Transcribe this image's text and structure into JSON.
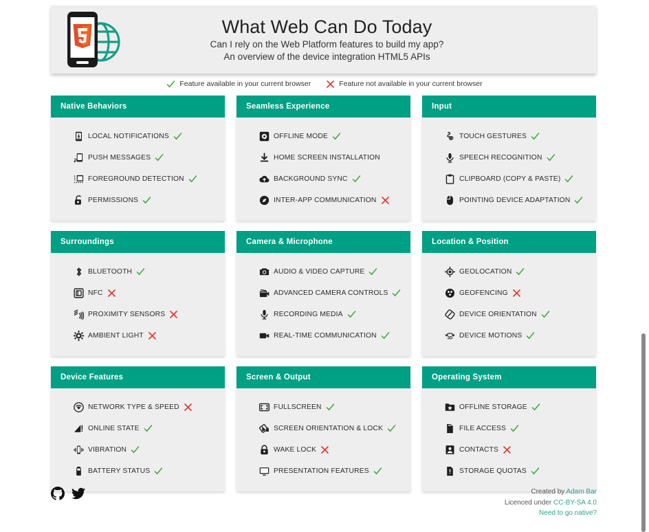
{
  "header": {
    "title": "What Web Can Do Today",
    "subtitle_line1": "Can I rely on the Web Platform features to build my app?",
    "subtitle_line2": "An overview of the device integration HTML5 APIs",
    "logo_icon": "html5-phone-globe-logo"
  },
  "legend": {
    "available": {
      "icon": "check-icon",
      "text": "Feature available in your current browser"
    },
    "unavailable": {
      "icon": "cross-icon",
      "text": "Feature not available in your current browser"
    }
  },
  "colors": {
    "accent_teal": "#00a085",
    "card_bg": "#eeeeee",
    "check_green": "#3aa93a",
    "cross_red": "#e03a2f",
    "link_teal": "#2aa58e",
    "html5_orange": "#e44d26"
  },
  "cards": [
    {
      "title": "Native Behaviors",
      "features": [
        {
          "label": "LOCAL NOTIFICATIONS",
          "icon": "notification-phone-icon",
          "status": "available"
        },
        {
          "label": "PUSH MESSAGES",
          "icon": "push-phone-icon",
          "status": "available"
        },
        {
          "label": "FOREGROUND DETECTION",
          "icon": "foreground-window-icon",
          "status": "available"
        },
        {
          "label": "PERMISSIONS",
          "icon": "lock-open-icon",
          "status": "available"
        }
      ]
    },
    {
      "title": "Seamless Experience",
      "features": [
        {
          "label": "OFFLINE MODE",
          "icon": "offline-gear-icon",
          "status": "available"
        },
        {
          "label": "HOME SCREEN INSTALLATION",
          "icon": "download-arrow-icon",
          "status": "none"
        },
        {
          "label": "BACKGROUND SYNC",
          "icon": "cloud-upload-icon",
          "status": "available"
        },
        {
          "label": "INTER-APP COMMUNICATION",
          "icon": "compass-icon",
          "status": "unavailable"
        }
      ]
    },
    {
      "title": "Input",
      "features": [
        {
          "label": "TOUCH GESTURES",
          "icon": "touch-gesture-icon",
          "status": "available"
        },
        {
          "label": "SPEECH RECOGNITION",
          "icon": "microphone-icon",
          "status": "available"
        },
        {
          "label": "CLIPBOARD (COPY & PASTE)",
          "icon": "clipboard-icon",
          "status": "available"
        },
        {
          "label": "POINTING DEVICE ADAPTATION",
          "icon": "mouse-icon",
          "status": "available"
        }
      ]
    },
    {
      "title": "Surroundings",
      "features": [
        {
          "label": "BLUETOOTH",
          "icon": "bluetooth-icon",
          "status": "available"
        },
        {
          "label": "NFC",
          "icon": "nfc-icon",
          "status": "unavailable"
        },
        {
          "label": "PROXIMITY SENSORS",
          "icon": "proximity-waves-icon",
          "status": "unavailable"
        },
        {
          "label": "AMBIENT LIGHT",
          "icon": "sun-brightness-icon",
          "status": "unavailable"
        }
      ]
    },
    {
      "title": "Camera & Microphone",
      "features": [
        {
          "label": "AUDIO & VIDEO CAPTURE",
          "icon": "camera-icon",
          "status": "available"
        },
        {
          "label": "ADVANCED CAMERA CONTROLS",
          "icon": "film-camera-icon",
          "status": "available"
        },
        {
          "label": "RECORDING MEDIA",
          "icon": "microphone-icon",
          "status": "available"
        },
        {
          "label": "REAL-TIME COMMUNICATION",
          "icon": "video-camera-icon",
          "status": "available"
        }
      ]
    },
    {
      "title": "Location & Position",
      "features": [
        {
          "label": "GEOLOCATION",
          "icon": "crosshair-target-icon",
          "status": "available"
        },
        {
          "label": "GEOFENCING",
          "icon": "geofence-circle-icon",
          "status": "unavailable"
        },
        {
          "label": "DEVICE ORIENTATION",
          "icon": "rotate-device-icon",
          "status": "available"
        },
        {
          "label": "DEVICE MOTIONS",
          "icon": "three-d-motion-icon",
          "status": "available"
        }
      ]
    },
    {
      "title": "Device Features",
      "features": [
        {
          "label": "NETWORK TYPE & SPEED",
          "icon": "network-signal-icon",
          "status": "unavailable"
        },
        {
          "label": "ONLINE STATE",
          "icon": "signal-bars-alert-icon",
          "status": "available"
        },
        {
          "label": "VIBRATION",
          "icon": "vibration-phone-icon",
          "status": "available"
        },
        {
          "label": "BATTERY STATUS",
          "icon": "battery-icon",
          "status": "available"
        }
      ]
    },
    {
      "title": "Screen & Output",
      "features": [
        {
          "label": "FULLSCREEN",
          "icon": "fullscreen-icon",
          "status": "available"
        },
        {
          "label": "SCREEN ORIENTATION & LOCK",
          "icon": "screen-rotate-lock-icon",
          "status": "available"
        },
        {
          "label": "WAKE LOCK",
          "icon": "lock-closed-icon",
          "status": "unavailable"
        },
        {
          "label": "PRESENTATION FEATURES",
          "icon": "monitor-icon",
          "status": "available"
        }
      ]
    },
    {
      "title": "Operating System",
      "features": [
        {
          "label": "OFFLINE STORAGE",
          "icon": "folder-star-icon",
          "status": "available"
        },
        {
          "label": "FILE ACCESS",
          "icon": "sd-card-icon",
          "status": "available"
        },
        {
          "label": "CONTACTS",
          "icon": "contact-person-icon",
          "status": "unavailable"
        },
        {
          "label": "STORAGE QUOTAS",
          "icon": "storage-alert-icon",
          "status": "available"
        }
      ]
    }
  ],
  "footer": {
    "social": [
      {
        "icon": "github-icon",
        "name": "GitHub"
      },
      {
        "icon": "twitter-icon",
        "name": "Twitter"
      }
    ],
    "created_prefix": "Created by ",
    "created_link": "Adam Bar",
    "licence_prefix": "Licenced under ",
    "licence_link": "CC-BY-SA 4.0",
    "native_link": "Need to go native?"
  }
}
